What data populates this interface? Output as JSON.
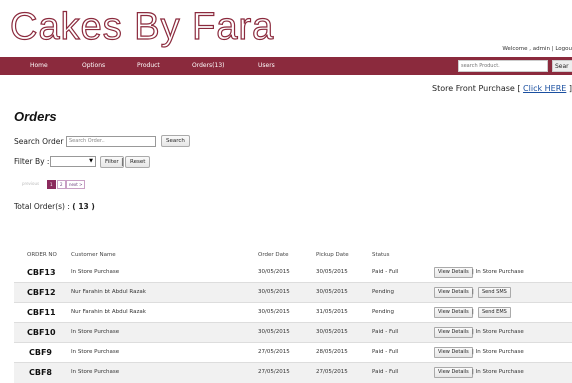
{
  "brand": "Cakes By Fara",
  "header": {
    "welcome_text": "Welcome , admin |",
    "logout": "Logou"
  },
  "nav": {
    "items": [
      "Home",
      "Options",
      "Product",
      "Orders(13)",
      "Users"
    ],
    "search_placeholder": "search Product.",
    "search_button": "Sear"
  },
  "store_front": {
    "text": "Store Front Purchase [",
    "link": "Click HERE",
    "close": "]"
  },
  "page_title": "Orders",
  "search": {
    "label": "Search Order :",
    "placeholder": "Search Order..",
    "button": "Search"
  },
  "filter": {
    "label": "Filter By :",
    "selected": "",
    "filter_button": "Filter",
    "separator": "|",
    "reset_button": "Reset"
  },
  "pagination": {
    "prev": "previous",
    "current": "1",
    "page2": "2",
    "next": "next >"
  },
  "total": {
    "label": "Total Order(s) :",
    "value": "( 13 )"
  },
  "table": {
    "headers": [
      "ORDER NO",
      "Customer Name",
      "Order Date",
      "Pickup Date",
      "Status"
    ],
    "rows": [
      {
        "no": "CBF13",
        "customer": "In Store Purchase",
        "order_date": "30/05/2015",
        "pickup_date": "30/05/2015",
        "status": "Paid - Full",
        "action": "View Details",
        "extra": "| In Store Purchase"
      },
      {
        "no": "CBF12",
        "customer": "Nur Farahin bt Abdul Razak",
        "order_date": "30/05/2015",
        "pickup_date": "30/05/2015",
        "status": "Pending",
        "action": "View Details",
        "extra": "Send SMS"
      },
      {
        "no": "CBF11",
        "customer": "Nur Farahin bt Abdul Razak",
        "order_date": "30/05/2015",
        "pickup_date": "31/05/2015",
        "status": "Pending",
        "action": "View Details",
        "extra": "Send EMS"
      },
      {
        "no": "CBF10",
        "customer": "In Store Purchase",
        "order_date": "30/05/2015",
        "pickup_date": "30/05/2015",
        "status": "Paid - Full",
        "action": "View Details",
        "extra": "| In Store Purchase"
      },
      {
        "no": "CBF9",
        "customer": "In Store Purchase",
        "order_date": "27/05/2015",
        "pickup_date": "28/05/2015",
        "status": "Paid - Full",
        "action": "View Details",
        "extra": "| In Store Purchase"
      },
      {
        "no": "CBF8",
        "customer": "In Store Purchase",
        "order_date": "27/05/2015",
        "pickup_date": "27/05/2015",
        "status": "Paid - Full",
        "action": "View Details",
        "extra": "| In Store Purchase"
      }
    ]
  },
  "colors": {
    "brand": "#8b2a3d",
    "link": "#1a4fa0"
  }
}
